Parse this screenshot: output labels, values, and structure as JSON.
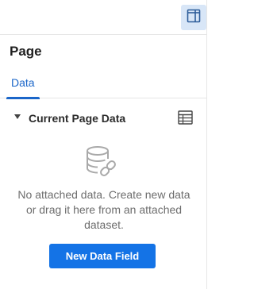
{
  "toolbar": {
    "panel_toggle_icon": "panel-layout-icon",
    "active_color": "#d8e6f7"
  },
  "panel": {
    "title": "Page"
  },
  "tabs": [
    {
      "label": "Data",
      "active": true
    }
  ],
  "section": {
    "title": "Current Page Data",
    "expanded": true,
    "action_icon": "table-icon"
  },
  "empty_state": {
    "icon": "database-link-icon",
    "message": "No attached data. Create new data or drag it here from an attached dataset.",
    "button_label": "New Data Field"
  },
  "colors": {
    "accent": "#1b66c9",
    "button": "#1473e6"
  }
}
